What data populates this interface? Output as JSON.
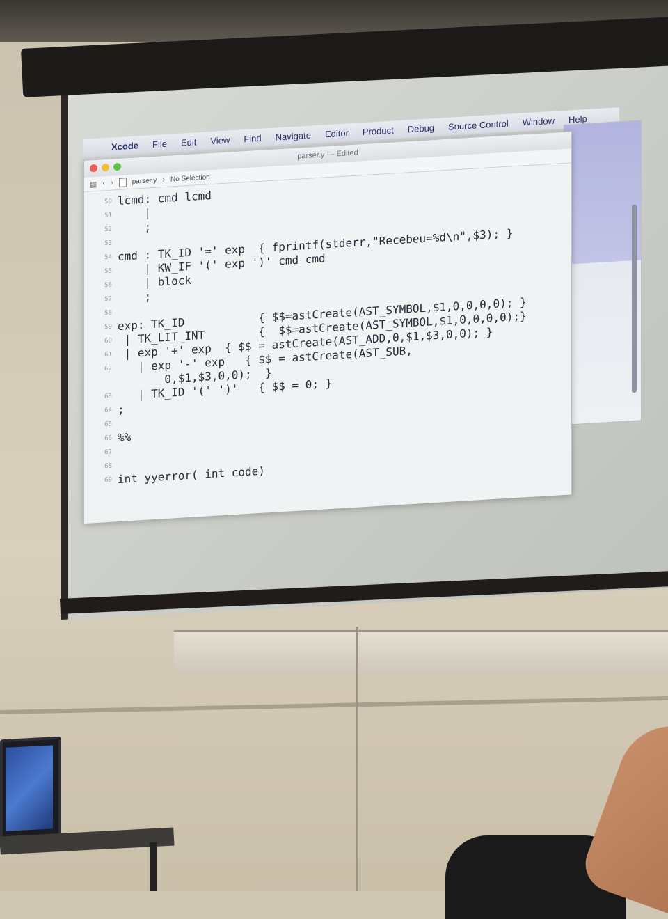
{
  "menubar": {
    "app": "Xcode",
    "items": [
      "File",
      "Edit",
      "View",
      "Find",
      "Navigate",
      "Editor",
      "Product",
      "Debug",
      "Source Control",
      "Window",
      "Help"
    ]
  },
  "window": {
    "title": "parser.y — Edited",
    "breadcrumb_file": "parser.y",
    "breadcrumb_selection": "No Selection"
  },
  "code_lines": [
    {
      "n": "50",
      "t": "lcmd: cmd lcmd"
    },
    {
      "n": "51",
      "t": "    |"
    },
    {
      "n": "52",
      "t": "    ;"
    },
    {
      "n": "53",
      "t": ""
    },
    {
      "n": "54",
      "t": "cmd : TK_ID '=' exp  { fprintf(stderr,\"Recebeu=%d\\n\",$3); }"
    },
    {
      "n": "55",
      "t": "    | KW_IF '(' exp ')' cmd cmd"
    },
    {
      "n": "56",
      "t": "    | block"
    },
    {
      "n": "57",
      "t": "    ;"
    },
    {
      "n": "58",
      "t": ""
    },
    {
      "n": "59",
      "t": "exp: TK_ID           { $$=astCreate(AST_SYMBOL,$1,0,0,0,0); }"
    },
    {
      "n": "60",
      "t": " | TK_LIT_INT        {  $$=astCreate(AST_SYMBOL,$1,0,0,0,0);}"
    },
    {
      "n": "61",
      "t": " | exp '+' exp  { $$ = astCreate(AST_ADD,0,$1,$3,0,0); }"
    },
    {
      "n": "62",
      "t": "   | exp '-' exp   { $$ = astCreate(AST_SUB,"
    },
    {
      "n": "",
      "t": "       0,$1,$3,0,0);  }"
    },
    {
      "n": "63",
      "t": "   | TK_ID '(' ')'   { $$ = 0; }"
    },
    {
      "n": "64",
      "t": ";"
    },
    {
      "n": "65",
      "t": ""
    },
    {
      "n": "66",
      "t": "%%"
    },
    {
      "n": "67",
      "t": ""
    },
    {
      "n": "68",
      "t": ""
    },
    {
      "n": "69",
      "t": "int yyerror( int code)"
    }
  ]
}
